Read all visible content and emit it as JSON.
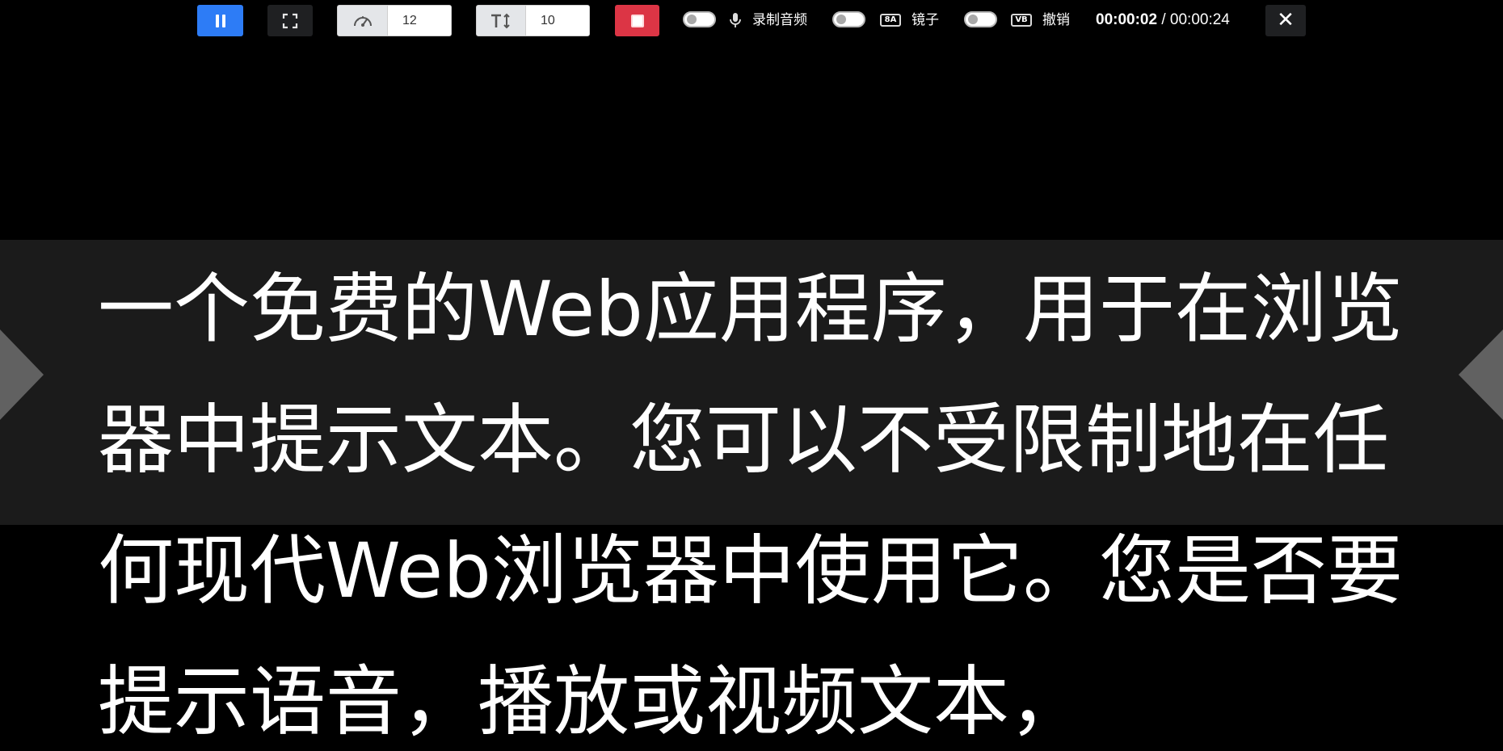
{
  "toolbar": {
    "pause_icon": "pause-icon",
    "fullscreen_icon": "fullscreen-icon",
    "speed": {
      "icon": "speedometer-icon",
      "value": "12"
    },
    "font_size": {
      "icon": "text-height-icon",
      "value": "10"
    },
    "stop_icon": "stop-icon",
    "options": {
      "audio": {
        "label": "录制音频",
        "icon": "microphone-icon",
        "enabled": false
      },
      "mirror": {
        "label": "镜子",
        "icon": "mirror-icon",
        "badge": "8A",
        "enabled": false
      },
      "undo": {
        "label": "撤销",
        "icon": "flip-icon",
        "badge": "VB",
        "enabled": false
      }
    },
    "timer": {
      "current": "00:00:02",
      "separator": " / ",
      "total": "00:00:24"
    },
    "close_label": "✕"
  },
  "prompter": {
    "text": "一个免费的Web应用程序，用于在浏览器中提示文本。您可以不受限制地在任何现代Web浏览器中使用它。您是否要提示语音，播放或视频文本，"
  },
  "colors": {
    "background": "#000000",
    "focus_band": "#1b1b1b",
    "primary": "#2d7cf6",
    "danger": "#dc3545",
    "marker": "#616161",
    "text": "#ffffff"
  }
}
